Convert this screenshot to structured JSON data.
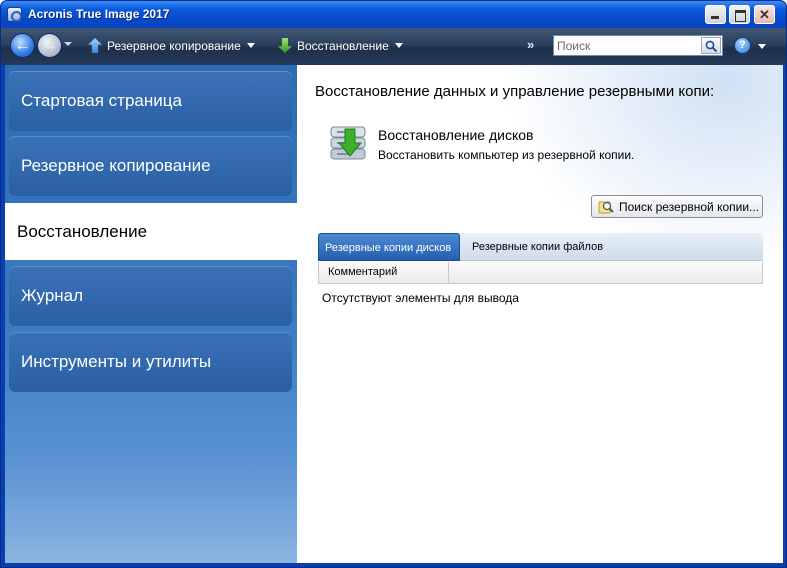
{
  "window": {
    "title": "Acronis True Image 2017",
    "app_icon": "acronis-app-icon",
    "close_glyph": "✕"
  },
  "toolbar": {
    "back_glyph": "←",
    "forward_glyph": "→",
    "backup_label": "Резервное копирование",
    "restore_label": "Восстановление",
    "overflow_glyph": "»",
    "search_placeholder": "Поиск",
    "help_glyph": "?"
  },
  "sidebar": {
    "items": [
      {
        "label": "Стартовая страница",
        "active": false
      },
      {
        "label": "Резервное копирование",
        "active": false
      },
      {
        "label": "Восстановление",
        "active": true
      },
      {
        "label": "Журнал",
        "active": false
      },
      {
        "label": "Инструменты и утилиты",
        "active": false
      }
    ]
  },
  "main": {
    "heading": "Восстановление данных и управление резервными копи:",
    "restore_disks": {
      "title": "Восстановление дисков",
      "description": "Восстановить компьютер из резервной копии."
    },
    "find_backup_label": "Поиск резервной копии...",
    "tabs": [
      {
        "label": "Резервные копии дисков",
        "active": true
      },
      {
        "label": "Резервные копии файлов",
        "active": false
      }
    ],
    "columns": [
      "Комментарий"
    ],
    "empty_text": "Отсутствуют элементы для вывода"
  },
  "colors": {
    "accent": "#245fb0",
    "titlebar": "#0548c9",
    "sidebar": "#2f6cb6",
    "toolbar": "#2b3f5c"
  }
}
